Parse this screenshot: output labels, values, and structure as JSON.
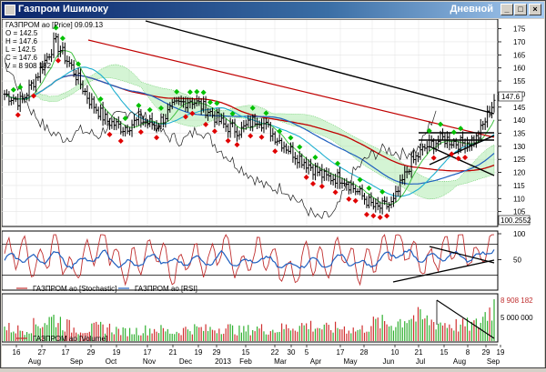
{
  "window": {
    "title": "Газпром Ишимоку",
    "timeframe": "Дневной",
    "controls": {
      "minimize": "_",
      "maximize": "□",
      "close": "×"
    }
  },
  "colors": {
    "price_bar": "#000000",
    "up_marker": "#00c000",
    "down_marker": "#e00000",
    "ma_red": "#c00000",
    "ma_blue": "#1f5fbf",
    "ma_cyan": "#20b0d0",
    "ma_green": "#40c040",
    "lagging": "#202020",
    "stoch": "#c03030",
    "rsi": "#1f5fbf",
    "volume": "#30b030",
    "volume_down": "#d03030"
  },
  "price_panel": {
    "legend": "ГАЗПРОМ ао [Price] 09.09.13",
    "ohlc": [
      "O = 142.5",
      "H = 147.6",
      "L = 142.5",
      "C = 147.6",
      "V = 8 908 182"
    ],
    "last_price": "147.6",
    "cursor_value": "100.2552"
  },
  "osc_panel": {
    "legend_stochastic": "ГАЗПРОМ ао [Stochastic]",
    "legend_rsi": "ГАЗПРОМ ао [RSI]"
  },
  "volume_panel": {
    "legend": "ГАЗПРОМ ао [Volume]",
    "last_volume": "8 908 182",
    "label_mid": "5 000 000"
  },
  "chart_data": [
    {
      "type": "candlestick",
      "title": "",
      "y_ticks": [
        105,
        110,
        115,
        120,
        125,
        130,
        135,
        140,
        145,
        150,
        155,
        160,
        165,
        170,
        175
      ],
      "ylim": [
        100,
        178
      ],
      "close_series": [
        {
          "date": "2012-08-16",
          "close": 150
        },
        {
          "date": "2012-08-27",
          "close": 147
        },
        {
          "date": "2012-09-10",
          "close": 158
        },
        {
          "date": "2012-09-20",
          "close": 170
        },
        {
          "date": "2012-10-01",
          "close": 160
        },
        {
          "date": "2012-10-15",
          "close": 148
        },
        {
          "date": "2012-10-29",
          "close": 140
        },
        {
          "date": "2012-11-12",
          "close": 137
        },
        {
          "date": "2012-11-26",
          "close": 140
        },
        {
          "date": "2012-12-10",
          "close": 138
        },
        {
          "date": "2012-12-24",
          "close": 145
        },
        {
          "date": "2013-01-09",
          "close": 148
        },
        {
          "date": "2013-01-21",
          "close": 144
        },
        {
          "date": "2013-02-04",
          "close": 138
        },
        {
          "date": "2013-02-18",
          "close": 136
        },
        {
          "date": "2013-03-04",
          "close": 141
        },
        {
          "date": "2013-03-18",
          "close": 134
        },
        {
          "date": "2013-04-01",
          "close": 128
        },
        {
          "date": "2013-04-15",
          "close": 123
        },
        {
          "date": "2013-04-29",
          "close": 118
        },
        {
          "date": "2013-05-13",
          "close": 118
        },
        {
          "date": "2013-05-27",
          "close": 112
        },
        {
          "date": "2013-06-10",
          "close": 106
        },
        {
          "date": "2013-06-24",
          "close": 108
        },
        {
          "date": "2013-07-08",
          "close": 123
        },
        {
          "date": "2013-07-22",
          "close": 130
        },
        {
          "date": "2013-08-05",
          "close": 133
        },
        {
          "date": "2013-08-19",
          "close": 131
        },
        {
          "date": "2013-08-30",
          "close": 133
        },
        {
          "date": "2013-09-09",
          "close": 147.6
        }
      ]
    },
    {
      "type": "line",
      "title": "",
      "y_ticks": [
        50,
        100
      ],
      "ylim": [
        0,
        100
      ],
      "series": [
        {
          "name": "ГАЗПРОМ ао [Stochastic]",
          "values": [
            55,
            70,
            35,
            80,
            20,
            65,
            85,
            30,
            50,
            75,
            25,
            60,
            40,
            80,
            30,
            70,
            45,
            20,
            60,
            35,
            75,
            25,
            55,
            85,
            70,
            40,
            65,
            80,
            50,
            95
          ]
        },
        {
          "name": "ГАЗПРОМ ао [RSI]",
          "values": [
            50,
            55,
            48,
            60,
            40,
            52,
            58,
            38,
            45,
            55,
            42,
            50,
            46,
            58,
            40,
            52,
            45,
            35,
            48,
            40,
            55,
            38,
            45,
            62,
            60,
            52,
            55,
            58,
            52,
            75
          ]
        }
      ]
    },
    {
      "type": "bar",
      "title": "",
      "y_ticks": [
        5000000
      ],
      "ylim": [
        0,
        9500000
      ],
      "series": [
        {
          "name": "ГАЗПРОМ ао [Volume]",
          "values": [
            3200000.0,
            2600000.0,
            4100000.0,
            5500000.0,
            3000000.0,
            2800000.0,
            3400000.0,
            2200000.0,
            2500000.0,
            2900000.0,
            2000000.0,
            3100000.0,
            2700000.0,
            3300000.0,
            2400000.0,
            3000000.0,
            2600000.0,
            3500000.0,
            3800000.0,
            2900000.0,
            3200000.0,
            2500000.0,
            4400000.0,
            3900000.0,
            6000000.0,
            4800000.0,
            4200000.0,
            3600000.0,
            3900000.0,
            8908182.0
          ]
        }
      ]
    }
  ],
  "x_axis": {
    "day_labels": [
      "16",
      "27",
      "17",
      "29",
      "19",
      "17",
      "21",
      "19",
      "29",
      "15",
      "22",
      "30",
      "5",
      "17",
      "28",
      "10",
      "21",
      "15",
      "8",
      "29",
      "19",
      "9"
    ],
    "month_labels": [
      "Aug",
      "Sep",
      "Oct",
      "Nov",
      "Dec",
      "2013",
      "Feb",
      "Mar",
      "Apr",
      "May",
      "Jun",
      "Jul",
      "Aug",
      "Sep"
    ]
  }
}
